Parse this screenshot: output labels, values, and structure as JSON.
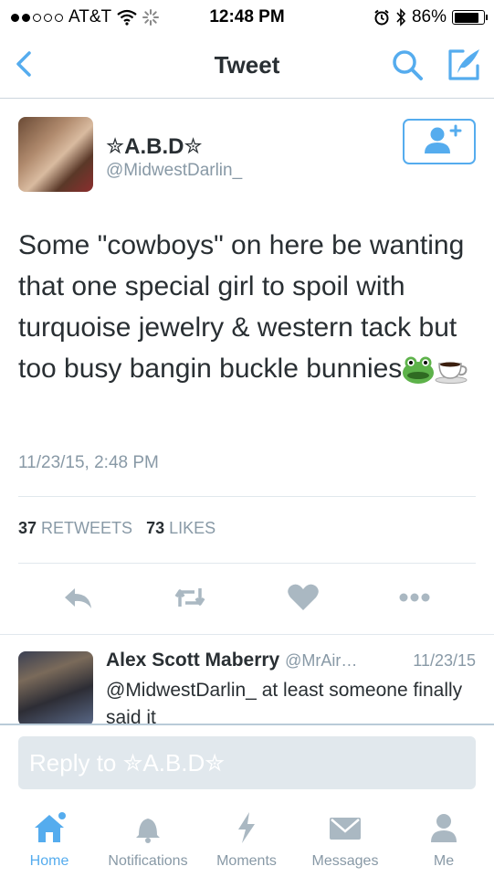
{
  "status_bar": {
    "carrier": "AT&T",
    "time": "12:48 PM",
    "battery_percent": "86%",
    "battery_level": 0.86
  },
  "nav": {
    "title": "Tweet"
  },
  "tweet": {
    "author_name": "✮A.B.D✮",
    "author_handle": "@MidwestDarlin_",
    "text": "Some \"cowboys\" on here be wanting that one special girl to spoil with turquoise jewelry & western tack but too busy bangin buckle bunnies",
    "timestamp": "11/23/15, 2:48 PM",
    "retweets_count": "37",
    "retweets_label": "RETWEETS",
    "likes_count": "73",
    "likes_label": "LIKES"
  },
  "reply": {
    "name": "Alex Scott Maberry",
    "handle": "@MrAir…",
    "date": "11/23/15",
    "text": "@MidwestDarlin_ at least someone finally said it"
  },
  "reply_box": {
    "placeholder": "Reply to ✮A.B.D✮"
  },
  "tabs": [
    {
      "label": "Home",
      "icon": "home-icon",
      "active": true
    },
    {
      "label": "Notifications",
      "icon": "bell-icon",
      "active": false
    },
    {
      "label": "Moments",
      "icon": "lightning-icon",
      "active": false
    },
    {
      "label": "Messages",
      "icon": "envelope-icon",
      "active": false
    },
    {
      "label": "Me",
      "icon": "person-icon",
      "active": false
    }
  ],
  "colors": {
    "accent": "#55acee",
    "text": "#292f33",
    "muted": "#8899a6",
    "divider": "#e1e8ed"
  }
}
